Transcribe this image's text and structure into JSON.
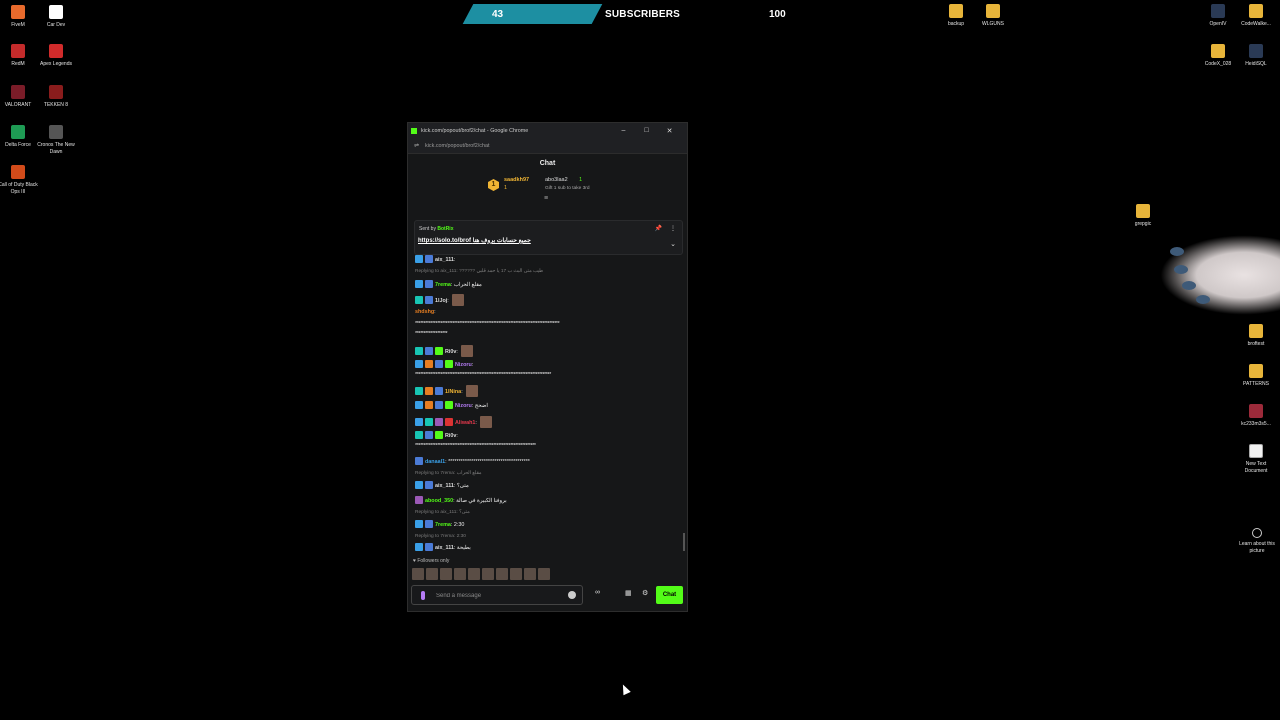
{
  "desktop": {
    "left_icons": [
      {
        "label": "FiveM",
        "color": "#e86a2c"
      },
      {
        "label": "Car Dev",
        "color": "#ffffff"
      },
      {
        "label": "RedM",
        "color": "#c42b2b"
      },
      {
        "label": "Apex Legends",
        "color": "#d12b2b"
      },
      {
        "label": "VALORANT",
        "color": "#7a1c28"
      },
      {
        "label": "TEKKEN 8",
        "color": "#8a1c1c"
      },
      {
        "label": "Delta Force",
        "color": "#1e9b54"
      },
      {
        "label": "Cronos The New Dawn",
        "color": "#555555"
      },
      {
        "label": "Call of Duty Black Ops III",
        "color": "#d24b1a"
      }
    ],
    "right_icons": [
      {
        "label": "backup",
        "type": "folder"
      },
      {
        "label": "WLGUNS",
        "type": "folder"
      },
      {
        "label": "OpenIV",
        "type": "app"
      },
      {
        "label": "CodeWalke...",
        "type": "folder"
      },
      {
        "label": "CodeX_028",
        "type": "folder"
      },
      {
        "label": "HeidiSQL",
        "type": "app"
      },
      {
        "label": "grepgic",
        "type": "folder"
      },
      {
        "label": "broftest",
        "type": "folder"
      },
      {
        "label": "PATTERNS",
        "type": "folder"
      },
      {
        "label": "kc233m3s5...",
        "type": "archive"
      },
      {
        "label": "New Text Document",
        "type": "file"
      }
    ],
    "learn_about": "Learn about this picture"
  },
  "subscribers": {
    "current": "43",
    "label": "SUBSCRIBERS",
    "goal": "100",
    "progress": 0.43,
    "accent": "#1d8fa2"
  },
  "browser": {
    "title": "kick.com/popout/brof2/chat - Google Chrome",
    "url": "kick.com/popout/brof2/chat",
    "buttons": {
      "minimize": "–",
      "maximize": "□",
      "close": "✕"
    }
  },
  "chat": {
    "header": "Chat",
    "top_gifter": {
      "rank": "1",
      "name": "saadkh97",
      "count": "1"
    },
    "second_gifter": {
      "name": "abo3laa2",
      "count": "1",
      "note": "Gift 1 sub to take 3rd"
    },
    "pinned": {
      "sent_by_prefix": "Sent by",
      "sent_by": "BotRix",
      "message": "https://solo.to/brof جميع حسابات بروف هنا"
    },
    "messages": [
      {
        "user": "aix_111",
        "text": ""
      },
      {
        "reply": "Replying to aix_111: ?????? طيب متى البث ب 17 يا حمد قلبي"
      },
      {
        "user": "7rema",
        "text": "مقلع الحراب"
      },
      {
        "user": "1lJoj",
        "text": ""
      },
      {
        "user": "shdshg",
        "text": ""
      },
      {
        "text": "*************************************************************************************"
      },
      {
        "text": "*******************"
      },
      {
        "user": "Ri0v",
        "text": ""
      },
      {
        "user": "Nizoru",
        "text": ""
      },
      {
        "text": "********************************************************************************"
      },
      {
        "user": "1lNina",
        "text": ""
      },
      {
        "user": "Nizoru",
        "text": "اضحج"
      },
      {
        "user": "Aliwah1",
        "text": ""
      },
      {
        "user": "Ri0v",
        "text": ""
      },
      {
        "text": "***********************************************************************"
      },
      {
        "user": "danaal1",
        "text": "***************************************"
      },
      {
        "reply": "Replying to 7rema: مقلع الحراب"
      },
      {
        "user": "aix_111",
        "text": "متى؟"
      },
      {
        "user": "abood_350",
        "text": "بروفنا الكبيرة في صالة"
      },
      {
        "reply": "Replying to aix_111: متى؟"
      },
      {
        "user": "7rema",
        "text": "2:30"
      },
      {
        "reply": "Replying to 7rema: 2:30"
      },
      {
        "user": "aix_111",
        "text": "بطيحة"
      }
    ],
    "followers_only": "Followers only",
    "input_placeholder": "Send a message",
    "send_label": "Chat",
    "accent": "#53fc18"
  }
}
